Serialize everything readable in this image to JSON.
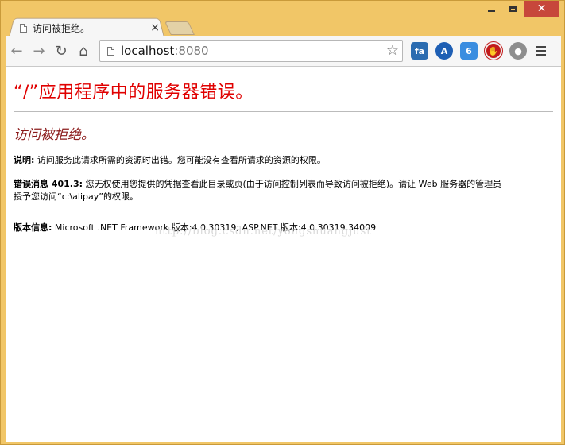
{
  "window": {
    "minimize_label": "",
    "maximize_label": "",
    "close_label": "✕"
  },
  "tab": {
    "title": "访问被拒绝。",
    "close": "×"
  },
  "toolbar": {
    "back": "←",
    "forward": "→",
    "reload": "↻",
    "home": "⌂",
    "url_host": "localhost",
    "url_port": ":8080",
    "star": "☆",
    "extensions": [
      {
        "name": "fa-extension-icon",
        "glyph": "fa"
      },
      {
        "name": "a-extension-icon",
        "glyph": "A"
      },
      {
        "name": "six-extension-icon",
        "glyph": "6"
      },
      {
        "name": "stop-extension-icon",
        "glyph": "✋"
      },
      {
        "name": "globe-extension-icon",
        "glyph": "●"
      }
    ]
  },
  "page": {
    "heading": "“/”应用程序中的服务器错误。",
    "subheading": "访问被拒绝。",
    "description_label": "说明:",
    "description_text": " 访问服务此请求所需的资源时出错。您可能没有查看所请求的资源的权限。",
    "error_label": "错误消息 401.3:",
    "error_text_1": " 您无权使用您提供的凭据查看此目录或页(由于访问控制列表而导致访问被拒绝)。请让 Web 服务器的管理员",
    "error_text_2": "授予您访问“c:\\alipay”的权限。",
    "version_label": "版本信息:",
    "version_text": " Microsoft .NET Framework 版本:4.0.30319; ASP.NET 版本:4.0.30319.34009",
    "watermark": "http://blog.csdn.net/yongshuangjust"
  }
}
